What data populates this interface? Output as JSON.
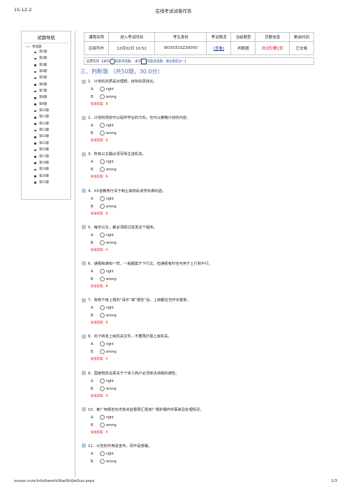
{
  "header": {
    "date": "15-12-2",
    "title": "在线考试试卷作答"
  },
  "footer": {
    "url": "zuoye.cnzx/info/kaoshi/KaoShiJieGuo.aspx",
    "page": "1/3"
  },
  "nav": {
    "title": "试题导航",
    "group": "一、单选题",
    "items": [
      "第1题",
      "第2题",
      "第3题",
      "第4题",
      "第5题",
      "第6题",
      "第7题",
      "第8题",
      "第9题",
      "第10题",
      "第11题",
      "第12题",
      "第13题",
      "第14题",
      "第15题",
      "第16题",
      "第17题",
      "第18题",
      "第19题",
      "第20题",
      "第21题"
    ]
  },
  "info": {
    "headers": [
      "课程名称",
      "进入考试时间",
      "考生身份",
      "考试情况",
      "当前题型",
      "页数信息",
      "剩余时间"
    ],
    "course": "应用写作",
    "time": "12月02日 10:52",
    "id": "W15031SZ30050",
    "status": "[查看]",
    "type": "判断题",
    "pages": "共3页/第2页",
    "remaining": "已交卷"
  },
  "legend": {
    "text1": "应用写作 【",
    "text2": "表示",
    "text3": "的是单选题，",
    "text4": "表示",
    "text5": "的是多选题，请注意区分！】"
  },
  "section": "三、判断题 （共50题，30.0分）",
  "options": {
    "a_label": "A.",
    "a_value": "right",
    "b_label": "B.",
    "b_value": "wrong"
  },
  "questions": [
    {
      "text": "1．计划的实质是对理想、目标的具体化。",
      "answer": "标准答案：B"
    },
    {
      "text": "2．计划的规划可以提供学业的方向，也可以策略计划的内容。",
      "answer": "标准答案：B"
    },
    {
      "text": "3．所有公文都必须写明主送机关。",
      "answer": "标准答案：B"
    },
    {
      "text": "4．XX省教育厅关于制止高校乱收学杂费的函。",
      "answer": "标准答案：B"
    },
    {
      "text": "5．每份公文，都必须经过签发这个程序。",
      "answer": "标准答案：A"
    },
    {
      "text": "6．通报和通知一样，一般都属于下行文，但通报有时也可用于上行和平行。",
      "answer": "标准答案：B"
    },
    {
      "text": "7．收到下级上报的“请示”或“报告”后，上级都应当作出答复。",
      "answer": "标准答案：B"
    },
    {
      "text": "8．向下转发上级机关文件，不要再抄报上级机关。",
      "answer": "标准答案：A"
    },
    {
      "text": "9．国家税务总局关于个体工商户必须依法纳税的通告。",
      "answer": "标准答案：A"
    },
    {
      "text": "10．某厂用报告向市技术监督局汇报该厂锅炉爆炸的事故及处理情况。",
      "answer": "标准答案：A"
    },
    {
      "text": "11．公告的作用是宣布，而不是部署。",
      "answer": ""
    }
  ]
}
